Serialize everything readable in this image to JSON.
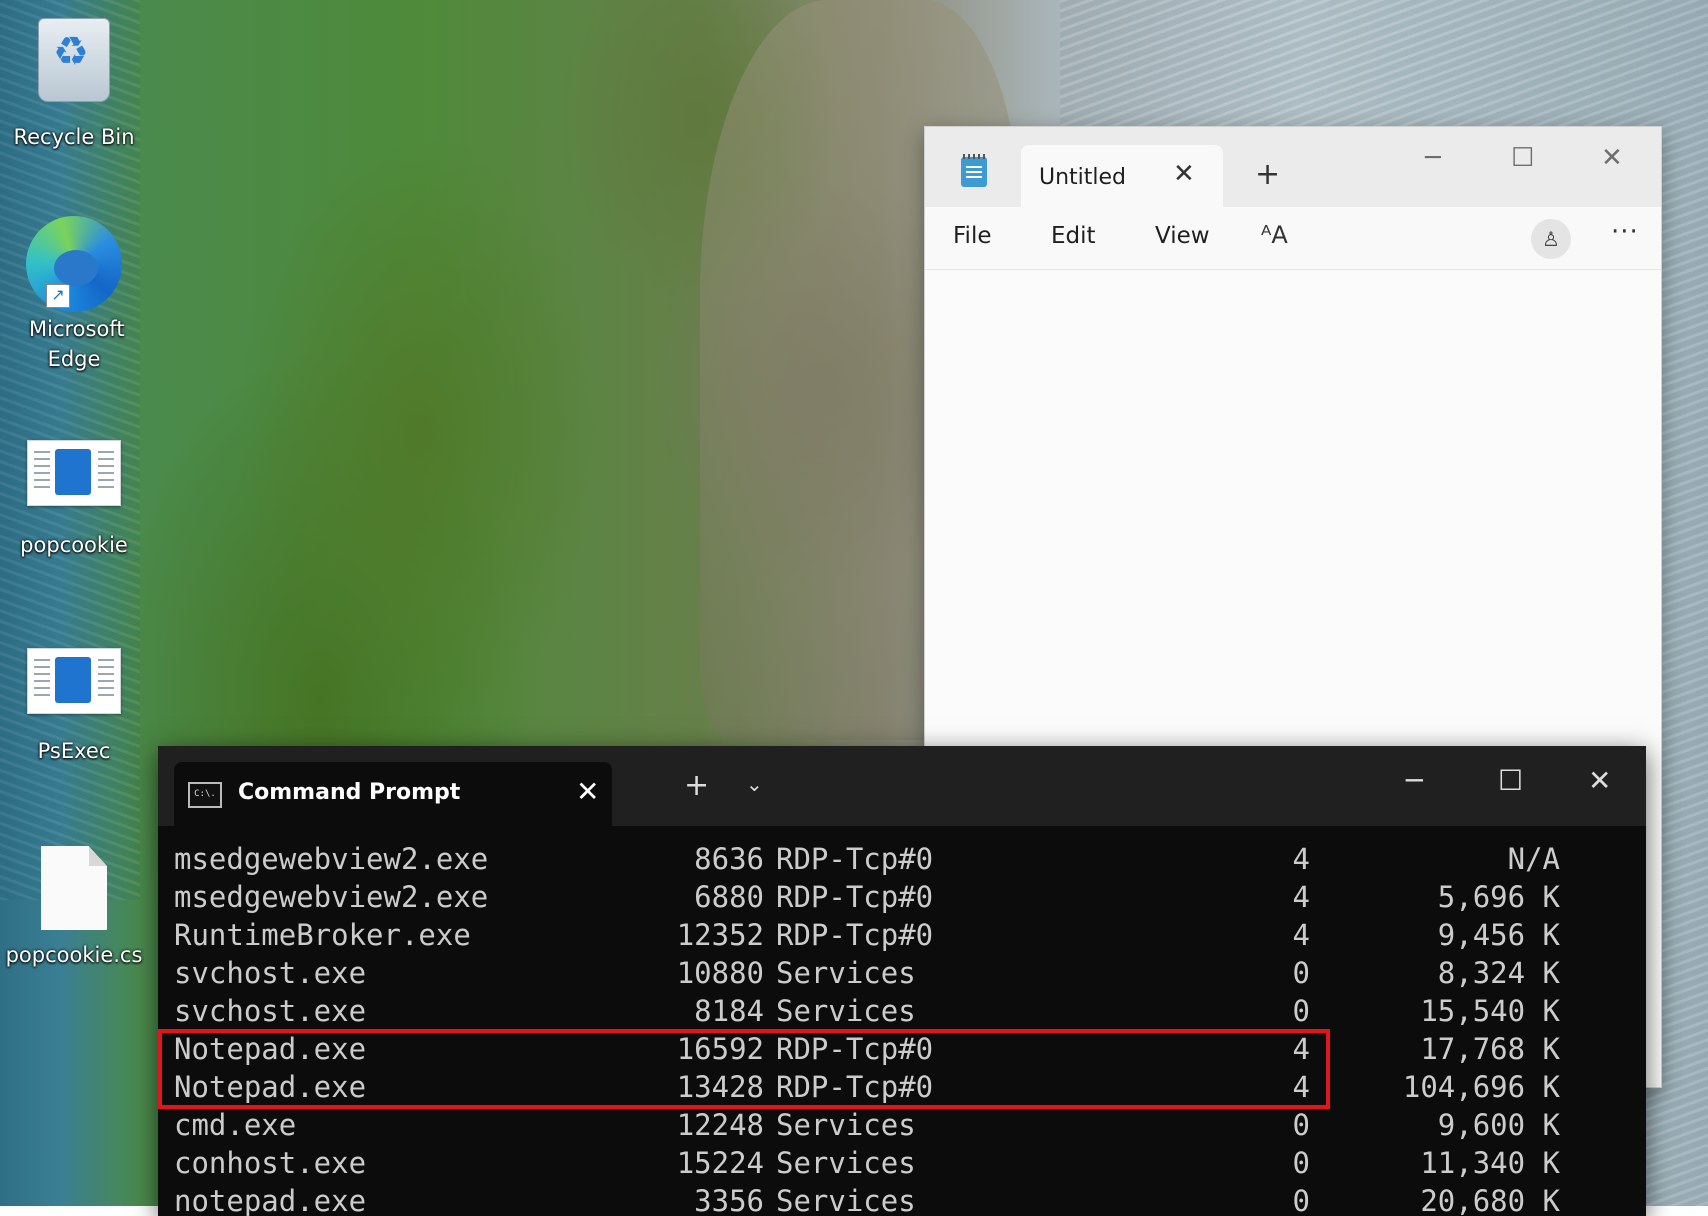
{
  "desktop": {
    "icons": [
      {
        "label": "Recycle Bin",
        "icon": "recycle-bin-icon"
      },
      {
        "label": "Microsoft Edge",
        "icon": "edge-icon"
      },
      {
        "label": "popcookie",
        "icon": "exe-file-icon"
      },
      {
        "label": "PsExec",
        "icon": "exe-file-icon"
      },
      {
        "label": "popcookie.cs",
        "icon": "blank-file-icon"
      }
    ]
  },
  "notepad": {
    "tab_title": "Untitled",
    "menu": [
      "File",
      "Edit",
      "View"
    ],
    "controls": {
      "minimize": "─",
      "maximize": "☐",
      "close": "✕"
    },
    "tab_close": "✕",
    "new_tab": "+",
    "format_glyph": "AA",
    "more": "···"
  },
  "terminal": {
    "tab_title": "Command Prompt",
    "tab_icon_text": "C:\\.",
    "tab_close": "✕",
    "new_tab": "+",
    "dropdown": "⌄",
    "controls": {
      "minimize": "─",
      "maximize": "☐",
      "close": "✕"
    },
    "rows": [
      {
        "name": "msedgewebview2.exe",
        "pid": "8636",
        "session": "RDP-Tcp#0",
        "num": "4",
        "mem": "N/A"
      },
      {
        "name": "msedgewebview2.exe",
        "pid": "6880",
        "session": "RDP-Tcp#0",
        "num": "4",
        "mem": "5,696 K"
      },
      {
        "name": "RuntimeBroker.exe",
        "pid": "12352",
        "session": "RDP-Tcp#0",
        "num": "4",
        "mem": "9,456 K"
      },
      {
        "name": "svchost.exe",
        "pid": "10880",
        "session": "Services",
        "num": "0",
        "mem": "8,324 K"
      },
      {
        "name": "svchost.exe",
        "pid": "8184",
        "session": "Services",
        "num": "0",
        "mem": "15,540 K"
      },
      {
        "name": "Notepad.exe",
        "pid": "16592",
        "session": "RDP-Tcp#0",
        "num": "4",
        "mem": "17,768 K"
      },
      {
        "name": "Notepad.exe",
        "pid": "13428",
        "session": "RDP-Tcp#0",
        "num": "4",
        "mem": "104,696 K"
      },
      {
        "name": "cmd.exe",
        "pid": "12248",
        "session": "Services",
        "num": "0",
        "mem": "9,600 K"
      },
      {
        "name": "conhost.exe",
        "pid": "15224",
        "session": "Services",
        "num": "0",
        "mem": "11,340 K"
      },
      {
        "name": "notepad.exe",
        "pid": "3356",
        "session": "Services",
        "num": "0",
        "mem": "20,680 K"
      }
    ],
    "highlight_color": "#e0161b"
  }
}
